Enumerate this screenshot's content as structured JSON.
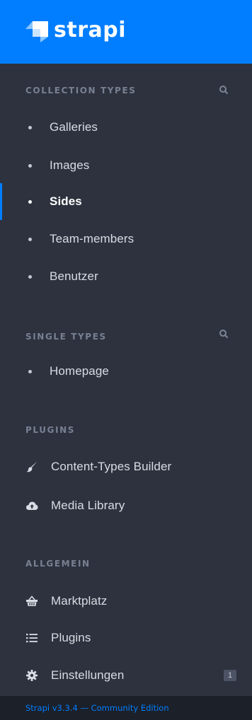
{
  "brand": {
    "name": "strapi",
    "accent": "#007eff"
  },
  "collection_types": {
    "title": "COLLECTION TYPES",
    "items": [
      {
        "label": "Galleries"
      },
      {
        "label": "Images"
      },
      {
        "label": "Sides",
        "active": true
      },
      {
        "label": "Team-members"
      },
      {
        "label": "Benutzer"
      }
    ]
  },
  "single_types": {
    "title": "SINGLE TYPES",
    "items": [
      {
        "label": "Homepage"
      }
    ]
  },
  "plugins": {
    "title": "PLUGINS",
    "items": [
      {
        "label": "Content-Types Builder",
        "icon": "paint-brush-icon"
      },
      {
        "label": "Media Library",
        "icon": "cloud-upload-icon"
      }
    ]
  },
  "general": {
    "title": "ALLGEMEIN",
    "items": [
      {
        "label": "Marktplatz",
        "icon": "basket-icon"
      },
      {
        "label": "Plugins",
        "icon": "list-icon"
      },
      {
        "label": "Einstellungen",
        "icon": "gear-icon",
        "badge": "1"
      }
    ]
  },
  "footer": {
    "text": "Strapi v3.3.4 — Community Edition"
  }
}
